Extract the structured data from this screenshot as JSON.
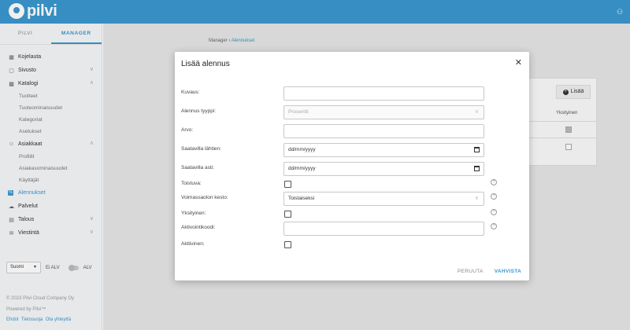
{
  "topbar": {
    "brand": "pilvi"
  },
  "sidebar": {
    "tabs": [
      {
        "label": "PILVI",
        "active": false
      },
      {
        "label": "MANAGER",
        "active": true
      }
    ],
    "items": [
      {
        "label": "Kojelauta",
        "icon": "dashboard-icon"
      },
      {
        "label": "Sivusto",
        "icon": "page-icon"
      },
      {
        "label": "Katalogi",
        "icon": "catalog-icon"
      },
      {
        "label": "Asiakkaat",
        "icon": "users-icon"
      },
      {
        "label": "Alennukset",
        "icon": "discount-icon"
      },
      {
        "label": "Palvelut",
        "icon": "cloud-icon"
      },
      {
        "label": "Talous",
        "icon": "ledger-icon"
      },
      {
        "label": "Viestintä",
        "icon": "mail-icon"
      }
    ],
    "katalogi_sub": [
      "Tuotteet",
      "Tuoteominaisuudet",
      "Kategoriat",
      "Asetukset"
    ],
    "asiakkaat_sub": [
      "Profiilit",
      "Asiakasominaisuudet",
      "Käyttäjät"
    ],
    "language": "Suomi",
    "alv_off": "Ei ALV",
    "alv_on": "ALV",
    "copyright": "© 2023 Pilvi Cloud Company Oy",
    "powered": "Powered by Pilvi™",
    "links": "Ehdot  Tietosuoja  Ota yhteyttä"
  },
  "breadcrumb": {
    "parent": "Manager",
    "separator": "›",
    "current": "Alennukset"
  },
  "background_card": {
    "add_label": "Lisää",
    "column": "Yksityinen"
  },
  "modal": {
    "title": "Lisää alennus",
    "fields": {
      "kuvaus": {
        "label": "Kuvaus:",
        "value": ""
      },
      "tyyppi": {
        "label": "Alennus tyyppi:",
        "value": "Prosentti"
      },
      "arvo": {
        "label": "Arvo:",
        "value": ""
      },
      "lahtien": {
        "label": "Saatavilla lähtien:",
        "placeholder": "dd/mm/yyyy"
      },
      "asti": {
        "label": "Saatavilla asti:",
        "placeholder": "dd/mm/yyyy"
      },
      "toistuva": {
        "label": "Toistuva:",
        "checked": false
      },
      "kesto": {
        "label": "Voimassaolon kesto:",
        "value": "Toistaiseksi"
      },
      "yksityinen": {
        "label": "Yksityinen:",
        "checked": false
      },
      "koodi": {
        "label": "Aktivointikoodi:",
        "value": ""
      },
      "aktiivinen": {
        "label": "Aktiivinen:",
        "checked": false
      }
    },
    "cancel": "PERUUTA",
    "confirm": "VAHVISTA"
  },
  "colors": {
    "brand": "#3b97cf"
  }
}
